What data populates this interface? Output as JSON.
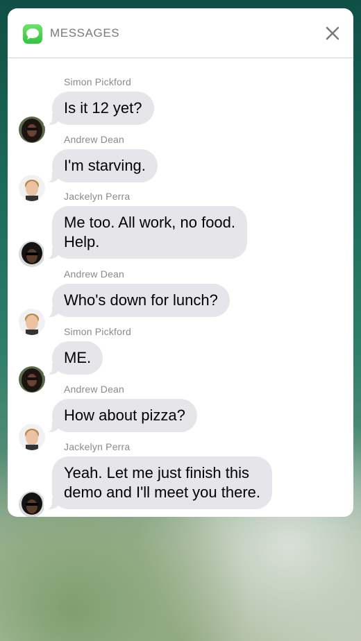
{
  "notification": {
    "app_name": "MESSAGES",
    "app_icon": "messages-bubble-icon",
    "close_icon": "close-icon"
  },
  "messages": [
    {
      "sender": "Simon Pickford",
      "text": "Is it 12 yet?",
      "avatar": "simon"
    },
    {
      "sender": "Andrew Dean",
      "text": "I'm starving.",
      "avatar": "andrew"
    },
    {
      "sender": "Jackelyn Perra",
      "text": "Me too. All work, no food.\nHelp.",
      "avatar": "jackelyn"
    },
    {
      "sender": "Andrew Dean",
      "text": "Who's down for lunch?",
      "avatar": "andrew"
    },
    {
      "sender": "Simon Pickford",
      "text": "ME.",
      "avatar": "simon"
    },
    {
      "sender": "Andrew Dean",
      "text": "How about pizza?",
      "avatar": "andrew"
    },
    {
      "sender": "Jackelyn Perra",
      "text": "Yeah. Let me just finish this\ndemo and I'll meet you there.",
      "avatar": "jackelyn"
    }
  ],
  "colors": {
    "bubble": "#e6e6ea",
    "app_icon_green": "#34c63f",
    "secondary_text": "#8a8a8e"
  }
}
